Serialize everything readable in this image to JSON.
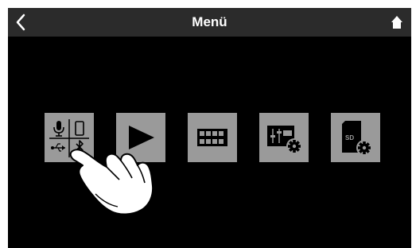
{
  "header": {
    "title": "Menü",
    "back_icon": "chevron-left-icon",
    "home_icon": "home-icon"
  },
  "menu": {
    "items": [
      {
        "icon": "input-source-icon",
        "sub_icons": [
          "microphone-icon",
          "smartphone-icon",
          "usb-icon",
          "bluetooth-icon"
        ]
      },
      {
        "icon": "play-icon"
      },
      {
        "icon": "pad-grid-icon"
      },
      {
        "icon": "mixer-settings-icon"
      },
      {
        "icon": "sd-card-settings-icon"
      }
    ]
  },
  "overlay": {
    "icon": "pointing-hand-icon"
  },
  "colors": {
    "background": "#000000",
    "topbar": "#2b2b2b",
    "tile": "#9a9a9a",
    "icon": "#000000",
    "title": "#ffffff"
  }
}
